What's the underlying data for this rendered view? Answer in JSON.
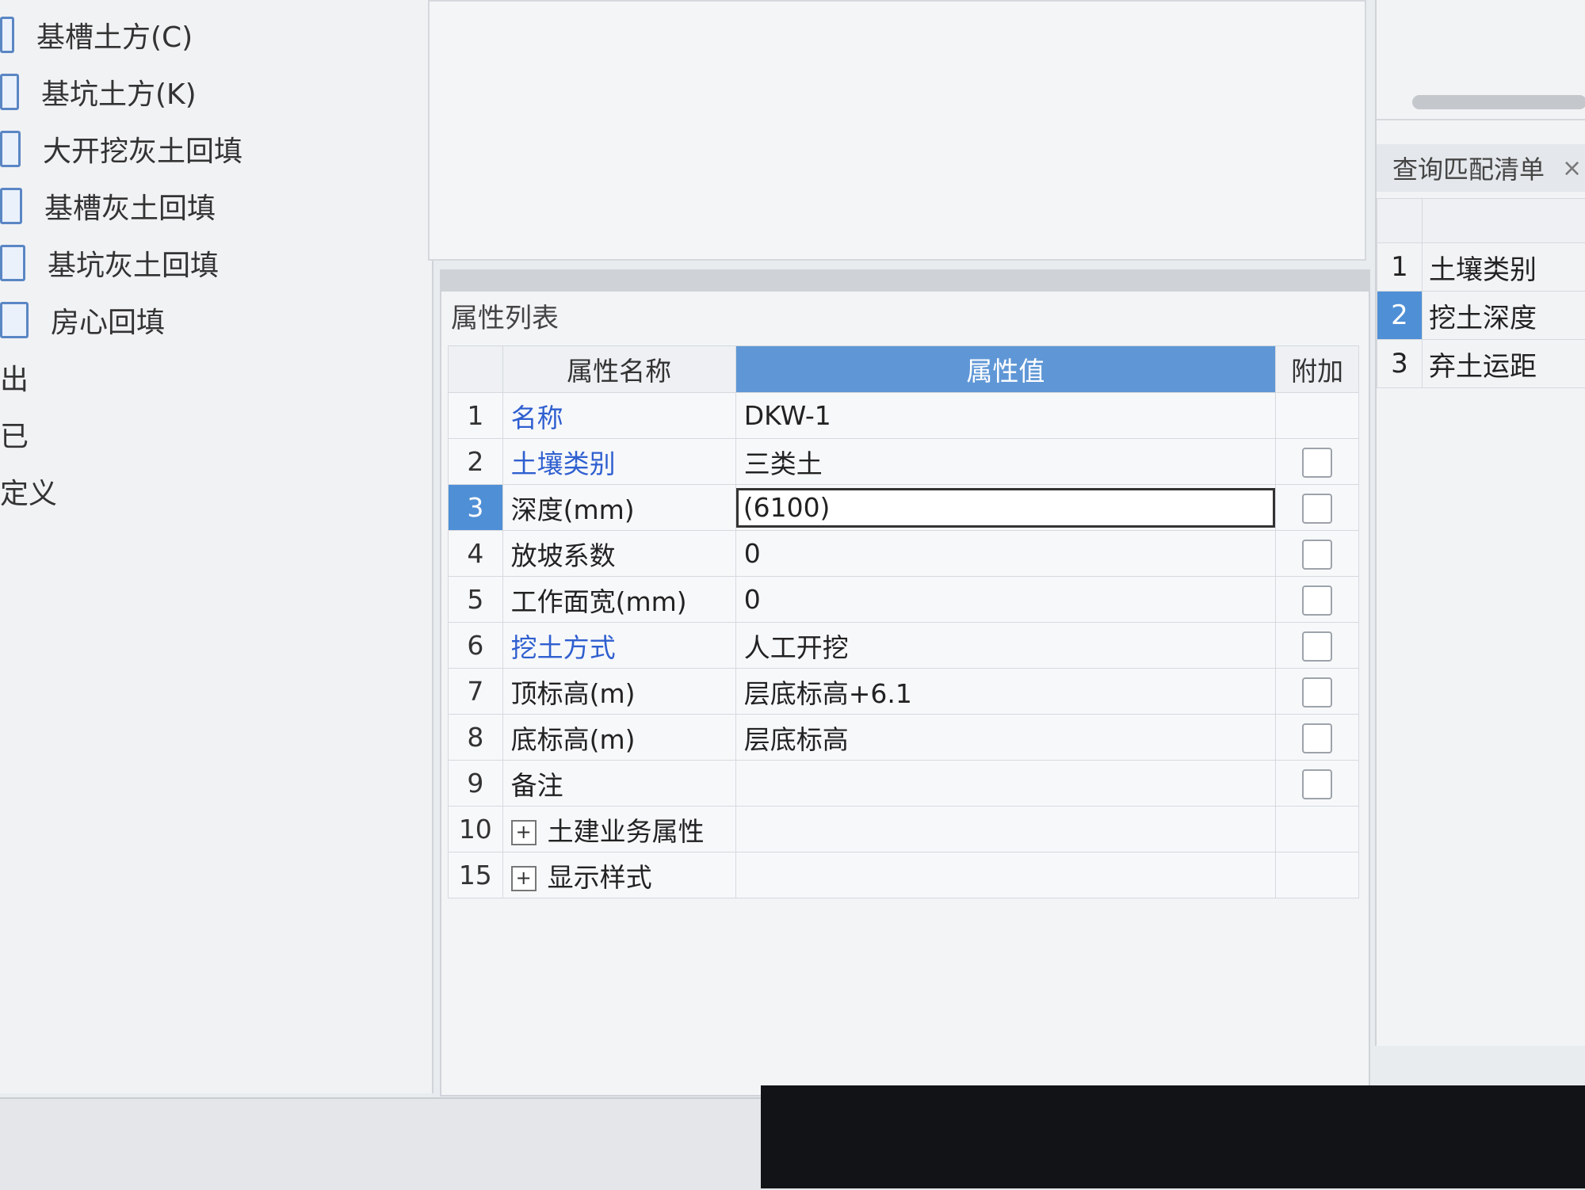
{
  "tree": {
    "items": [
      {
        "label": "基槽土方(C)"
      },
      {
        "label": "基坑土方(K)"
      },
      {
        "label": "大开挖灰土回填"
      },
      {
        "label": "基槽灰土回填"
      },
      {
        "label": "基坑灰土回填"
      },
      {
        "label": "房心回填"
      },
      {
        "label": "出"
      },
      {
        "label": "已"
      },
      {
        "label": "定义"
      }
    ]
  },
  "properties": {
    "title": "属性列表",
    "headers": {
      "name": "属性名称",
      "value": "属性值",
      "extra": "附加"
    },
    "rows": [
      {
        "num": "1",
        "name": "名称",
        "value": "DKW-1",
        "link": true,
        "checkbox": false
      },
      {
        "num": "2",
        "name": "土壤类别",
        "value": "三类土",
        "link": true,
        "checkbox": true
      },
      {
        "num": "3",
        "name": "深度(mm)",
        "value": "(6100)",
        "link": false,
        "checkbox": true,
        "selected": true
      },
      {
        "num": "4",
        "name": "放坡系数",
        "value": "0",
        "link": false,
        "checkbox": true
      },
      {
        "num": "5",
        "name": "工作面宽(mm)",
        "value": "0",
        "link": false,
        "checkbox": true
      },
      {
        "num": "6",
        "name": "挖土方式",
        "value": "人工开挖",
        "link": true,
        "checkbox": true
      },
      {
        "num": "7",
        "name": "顶标高(m)",
        "value": "层底标高+6.1",
        "link": false,
        "checkbox": true
      },
      {
        "num": "8",
        "name": "底标高(m)",
        "value": "层底标高",
        "link": false,
        "checkbox": true
      },
      {
        "num": "9",
        "name": "备注",
        "value": "",
        "link": false,
        "checkbox": true
      },
      {
        "num": "10",
        "name": "土建业务属性",
        "value": "",
        "link": false,
        "checkbox": false,
        "expand": "+"
      },
      {
        "num": "15",
        "name": "显示样式",
        "value": "",
        "link": false,
        "checkbox": false,
        "expand": "+"
      }
    ]
  },
  "right": {
    "title": "查询匹配清单",
    "close": "×",
    "rows": [
      {
        "num": "1",
        "label": "土壤类别"
      },
      {
        "num": "2",
        "label": "挖土深度",
        "selected": true
      },
      {
        "num": "3",
        "label": "弃土运距"
      }
    ]
  },
  "colors": {
    "accent": "#5f97d6",
    "link": "#2f5fd0",
    "selected": "#4f8fd6"
  }
}
